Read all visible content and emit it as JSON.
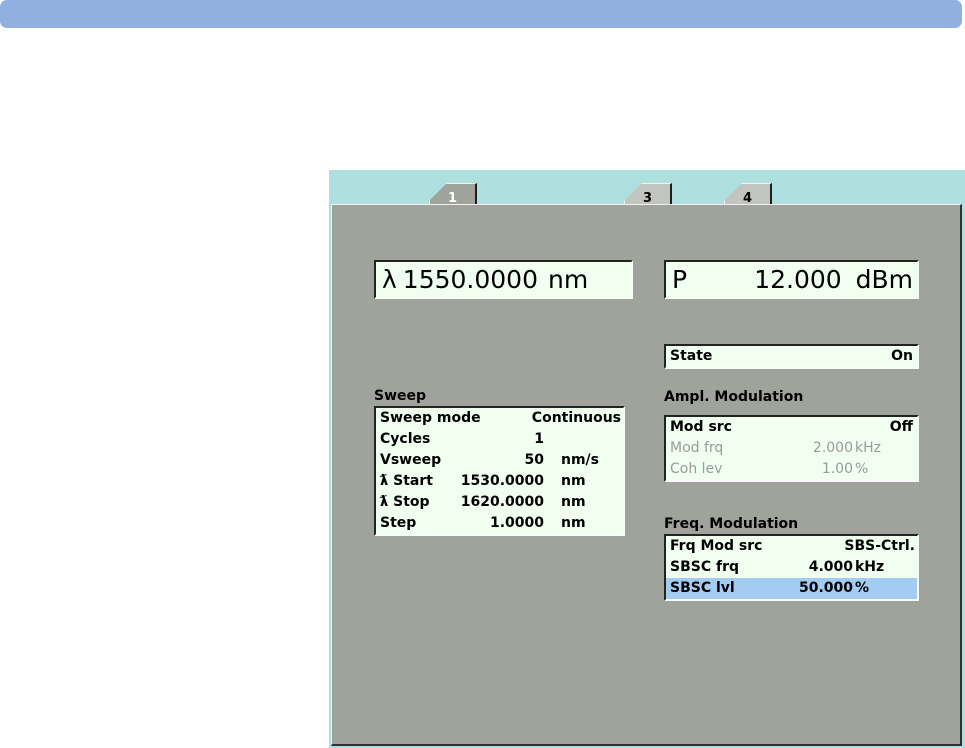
{
  "tabs": [
    {
      "label": "1",
      "active": true
    },
    {
      "label": "3",
      "active": false
    },
    {
      "label": "4",
      "active": false
    }
  ],
  "wavelength": {
    "symbol": "λ",
    "value": "1550.0000",
    "unit": "nm"
  },
  "power": {
    "symbol": "P",
    "value": "12.000",
    "unit": "dBm"
  },
  "state": {
    "label": "State",
    "value": "On"
  },
  "sweep": {
    "title": "Sweep",
    "rows": [
      {
        "label": "Sweep mode",
        "value": "Continuous",
        "unit": ""
      },
      {
        "label": "Cycles",
        "value": "1",
        "unit": ""
      },
      {
        "label": "Vsweep",
        "value": "50",
        "unit": "nm/s"
      },
      {
        "label": "ƛ Start",
        "value": "1530.0000",
        "unit": "nm"
      },
      {
        "label": "ƛ Stop",
        "value": "1620.0000",
        "unit": "nm"
      },
      {
        "label": "Step",
        "value": "1.0000",
        "unit": "nm"
      }
    ]
  },
  "ampl_modulation": {
    "title": "Ampl. Modulation",
    "rows": [
      {
        "label": "Mod src",
        "value": "Off",
        "unit": ""
      },
      {
        "label": "Mod frq",
        "value": "2.000",
        "unit": "kHz"
      },
      {
        "label": "Coh lev",
        "value": "1.00",
        "unit": "%"
      }
    ]
  },
  "freq_modulation": {
    "title": "Freq. Modulation",
    "rows": [
      {
        "label": "Frq Mod src",
        "value": "SBS-Ctrl.",
        "unit": ""
      },
      {
        "label": "SBSC frq",
        "value": "4.000",
        "unit": "kHz"
      },
      {
        "label": "SBSC lvl",
        "value": "50.000",
        "unit": "%"
      }
    ]
  },
  "colors": {
    "title_bar": "#8fb0e0",
    "instrument_background": "#aee0e0",
    "panel": "#a0a39c",
    "field": "#f0fff0",
    "selected_row": "#a4ccf2"
  }
}
